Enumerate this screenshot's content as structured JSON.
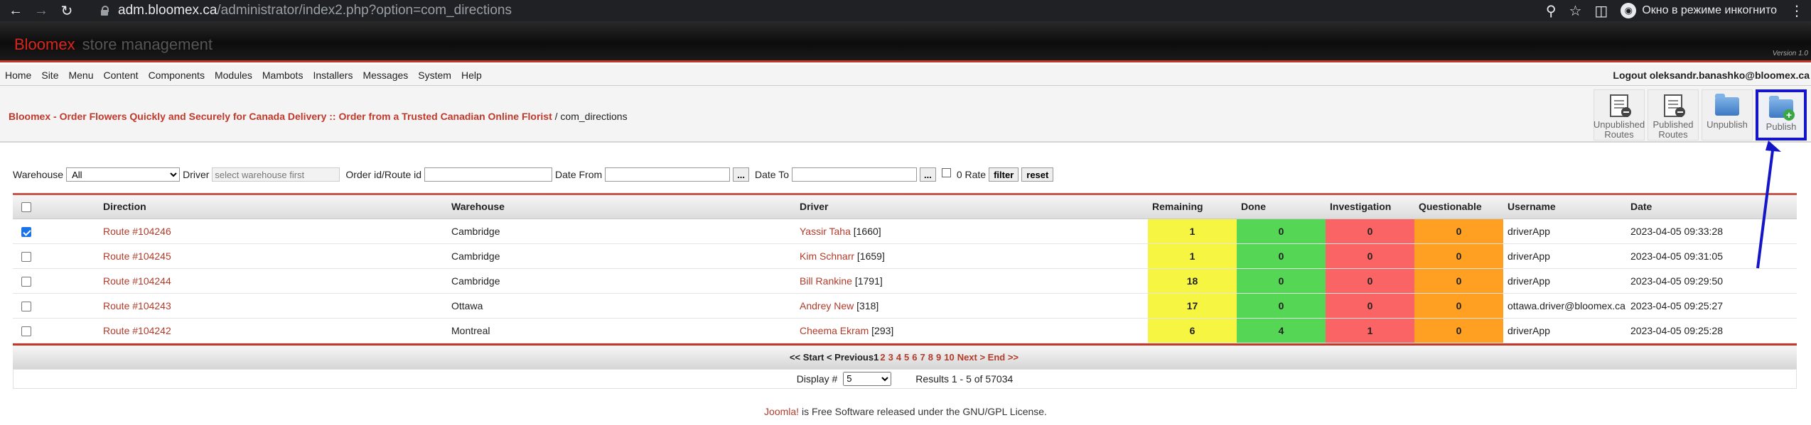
{
  "browser": {
    "url_host": "adm.bloomex.ca",
    "url_path": "/administrator/index2.php?option=com_directions",
    "incognito_label": "Окно в режиме инкогнито",
    "icons": [
      "back-icon",
      "forward-icon",
      "reload-icon",
      "lock-icon",
      "zoom-icon",
      "star-icon",
      "sidepanel-icon",
      "incognito-icon",
      "menu-icon"
    ]
  },
  "admin": {
    "brand_primary": "Bloomex",
    "brand_secondary": "store management",
    "version": "Version 1.0"
  },
  "menu": {
    "items": [
      "Home",
      "Site",
      "Menu",
      "Content",
      "Components",
      "Modules",
      "Mambots",
      "Installers",
      "Messages",
      "System",
      "Help"
    ],
    "logout": "Logout oleksandr.banashko@bloomex.ca"
  },
  "pathway": {
    "link": "Bloomex - Order Flowers Quickly and Securely for Canada Delivery :: Order from a Trusted Canadian Online Florist",
    "current": " / com_directions"
  },
  "toolbar": {
    "unpublished_routes": "Unpublished Routes",
    "published_routes": "Published Routes",
    "unpublish": "Unpublish",
    "publish": "Publish"
  },
  "filters": {
    "warehouse_label": "Warehouse",
    "warehouse_value": "All",
    "driver_label": "Driver",
    "driver_placeholder": "select warehouse first",
    "order_label": "Order id/Route id",
    "date_from_label": "Date From",
    "date_to_label": "Date To",
    "dots": "...",
    "rate_label": "0 Rate",
    "filter_btn": "filter",
    "reset_btn": "reset"
  },
  "table": {
    "headers": [
      "Direction",
      "Warehouse",
      "Driver",
      "Remaining",
      "Done",
      "Investigation",
      "Questionable",
      "Username",
      "Date"
    ],
    "rows": [
      {
        "direction": "Route #104246",
        "warehouse": "Cambridge",
        "driver": "Yassir Taha",
        "driver_id": " [1660]",
        "remaining": "1",
        "done": "0",
        "investigation": "0",
        "questionable": "0",
        "username": "driverApp",
        "date": "2023-04-05 09:33:28",
        "checked": true
      },
      {
        "direction": "Route #104245",
        "warehouse": "Cambridge",
        "driver": "Kim Schnarr",
        "driver_id": " [1659]",
        "remaining": "1",
        "done": "0",
        "investigation": "0",
        "questionable": "0",
        "username": "driverApp",
        "date": "2023-04-05 09:31:05",
        "checked": false
      },
      {
        "direction": "Route #104244",
        "warehouse": "Cambridge",
        "driver": "Bill Rankine",
        "driver_id": " [1791]",
        "remaining": "18",
        "done": "0",
        "investigation": "0",
        "questionable": "0",
        "username": "driverApp",
        "date": "2023-04-05 09:29:50",
        "checked": false
      },
      {
        "direction": "Route #104243",
        "warehouse": "Ottawa",
        "driver": "Andrey New",
        "driver_id": " [318]",
        "remaining": "17",
        "done": "0",
        "investigation": "0",
        "questionable": "0",
        "username": "ottawa.driver@bloomex.ca",
        "date": "2023-04-05 09:25:27",
        "checked": false
      },
      {
        "direction": "Route #104242",
        "warehouse": "Montreal",
        "driver": "Cheema Ekram",
        "driver_id": " [293]",
        "remaining": "6",
        "done": "4",
        "investigation": "1",
        "questionable": "0",
        "username": "driverApp",
        "date": "2023-04-05 09:25:28",
        "checked": false
      }
    ]
  },
  "pager": {
    "start_prev": "<< Start < Previous ",
    "current": "1",
    "pages": [
      "2",
      "3",
      "4",
      "5",
      "6",
      "7",
      "8",
      "9",
      "10"
    ],
    "next_end": "Next > End >>",
    "display_label": "Display #",
    "display_value": "5",
    "results": "Results 1 - 5 of 57034"
  },
  "footer": {
    "link": "Joomla!",
    "text": " is Free Software released under the GNU/GPL License."
  },
  "colors": {
    "remaining": "#f5f542",
    "done": "#55d655",
    "investigation": "#fa6464",
    "questionable": "#ffa022",
    "annotation": "#1414c8"
  }
}
